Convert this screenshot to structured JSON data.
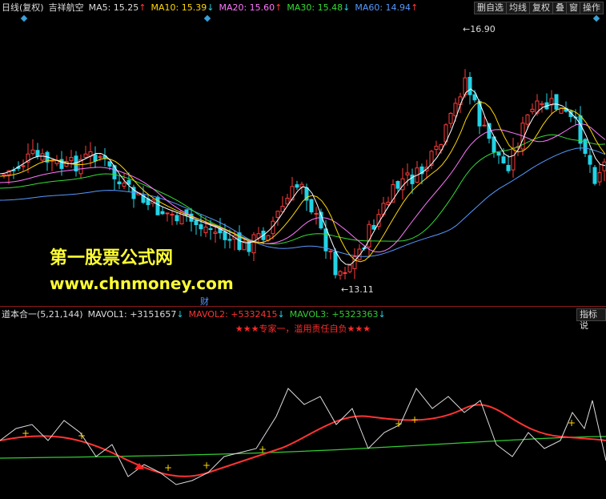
{
  "header": {
    "period": "日线(复权)",
    "stock_name": "吉祥航空",
    "ma": [
      {
        "label": "MA5: 15.25",
        "arrow": "↑",
        "color": "#ffffff"
      },
      {
        "label": "MA10: 15.39",
        "arrow": "↓",
        "color": "#ffd700"
      },
      {
        "label": "MA20: 15.60",
        "arrow": "↑",
        "color": "#ff77ff"
      },
      {
        "label": "MA30: 15.48",
        "arrow": "↓",
        "color": "#33dd33"
      },
      {
        "label": "MA60: 14.94",
        "arrow": "↑",
        "color": "#5599ff"
      }
    ],
    "buttons": [
      "删自选",
      "均线",
      "复权",
      "叠",
      "窗",
      "操作"
    ]
  },
  "main_chart": {
    "high_label": "16.90",
    "low_label": "13.11",
    "finance_marker": "财",
    "watermark_title": "第一股票公式网",
    "watermark_url": "www.chnmoney.com"
  },
  "indicator": {
    "name": "道本合一(5,21,144)",
    "mavol1": "MAVOL1: +3151657",
    "mavol1_arrow": "↓",
    "mavol2": "MAVOL2: +5332415",
    "mavol2_arrow": "↓",
    "mavol3": "MAVOL3: +5323363",
    "mavol3_arrow": "↓",
    "button": "指标说",
    "slogan": "★★★专家一，滥用责任自负★★★"
  },
  "colors": {
    "up": "#ff3b3b",
    "down": "#22d3e6",
    "ma5": "#ffffff",
    "ma10": "#ffd700",
    "ma20": "#ff77ff",
    "ma30": "#33dd33",
    "ma60": "#5599ff",
    "ind_red": "#ff3333",
    "ind_green": "#33cc33",
    "ind_white": "#dddddd"
  },
  "icons": [
    "diamond-marker-icon",
    "arrow-left-icon",
    "cross-marker-icon",
    "triangle-marker-icon"
  ]
}
